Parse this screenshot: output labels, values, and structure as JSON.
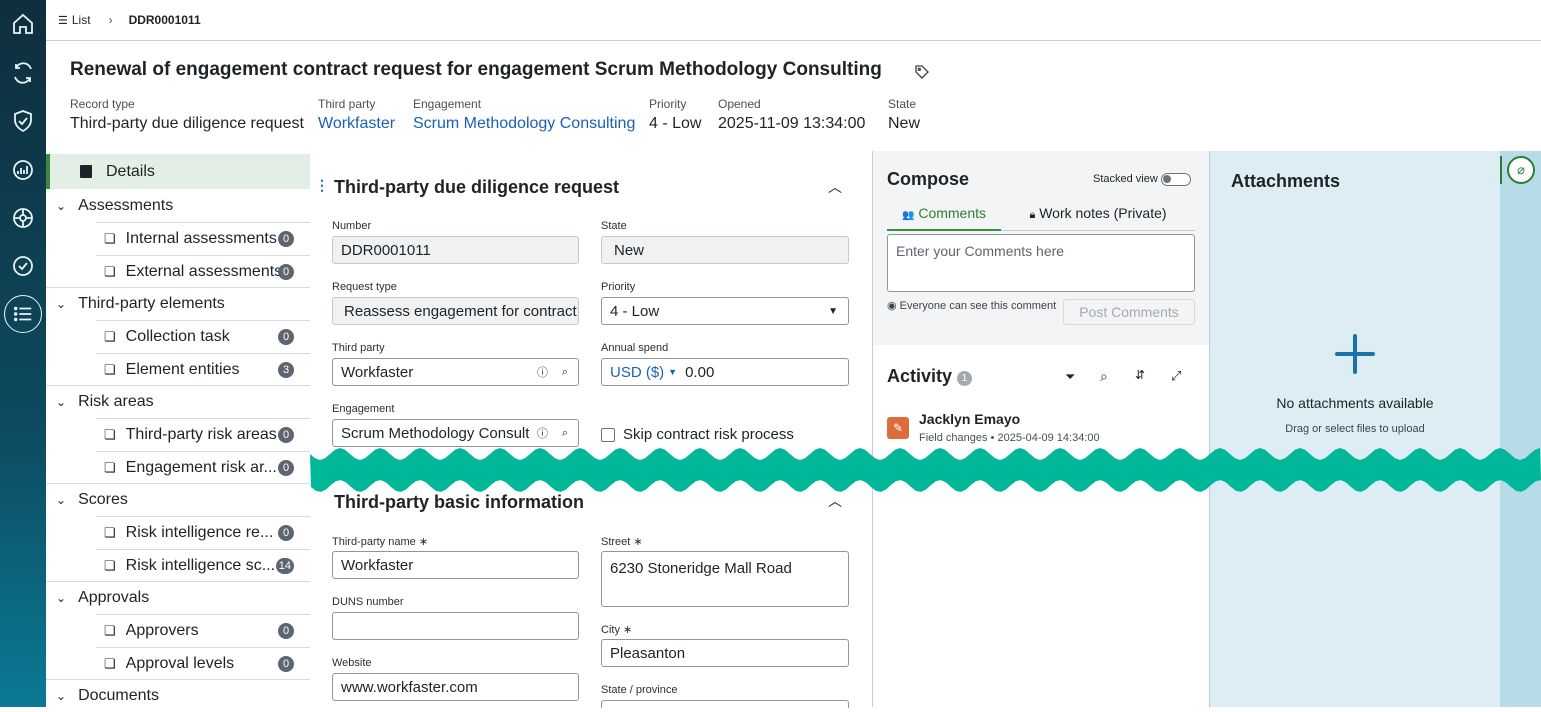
{
  "rail": {
    "icons": [
      "home-icon",
      "refresh-icon",
      "shield-check-icon",
      "analytics-icon",
      "palette-icon",
      "check-circle-icon",
      "list-icon"
    ]
  },
  "breadcrumb": {
    "list_label": "List",
    "record": "DDR0001011"
  },
  "header": {
    "title": "Renewal of engagement contract request for engagement Scrum Methodology Consulting",
    "fields": [
      {
        "label": "Record type",
        "value": "Third-party due diligence request"
      },
      {
        "label": "Third party",
        "value": "Workfaster"
      },
      {
        "label": "Engagement",
        "value": "Scrum Methodology Consulting"
      },
      {
        "label": "Priority",
        "value": "4 - Low"
      },
      {
        "label": "Opened",
        "value": "2025-11-09 13:34:00"
      },
      {
        "label": "State",
        "value": "New"
      }
    ]
  },
  "nav": {
    "details": "Details",
    "groups": [
      {
        "label": "Assessments",
        "items": [
          {
            "label": "Internal assessments",
            "count": "0"
          },
          {
            "label": "External assessments",
            "count": "0"
          }
        ]
      },
      {
        "label": "Third-party elements",
        "items": [
          {
            "label": "Collection task",
            "count": "0"
          },
          {
            "label": "Element entities",
            "count": "3"
          }
        ]
      },
      {
        "label": "Risk areas",
        "items": [
          {
            "label": "Third-party risk areas",
            "count": "0"
          },
          {
            "label": "Engagement risk ar...",
            "count": "0"
          }
        ]
      },
      {
        "label": "Scores",
        "items": [
          {
            "label": "Risk intelligence re...",
            "count": "0"
          },
          {
            "label": "Risk intelligence sc...",
            "count": "14"
          }
        ]
      },
      {
        "label": "Approvals",
        "items": [
          {
            "label": "Approvers",
            "count": "0"
          },
          {
            "label": "Approval levels",
            "count": "0"
          }
        ]
      },
      {
        "label": "Documents",
        "items": []
      }
    ]
  },
  "form": {
    "section1": "Third-party due diligence request",
    "number_label": "Number",
    "number": "DDR0001011",
    "state_label": "State",
    "state": "New",
    "request_type_label": "Request type",
    "request_type": "Reassess engagement for contract r",
    "priority_label": "Priority",
    "priority": "4 - Low",
    "third_party_label": "Third party",
    "third_party": "Workfaster",
    "annual_spend_label": "Annual spend",
    "currency": "USD ($)",
    "annual_spend": "0.00",
    "engagement_label": "Engagement",
    "engagement": "Scrum Methodology Consultir",
    "skip_label": "Skip contract risk process",
    "section2": "Third-party basic information",
    "tp_name_label": "Third-party name",
    "tp_name": "Workfaster",
    "street_label": "Street",
    "street": "6230 Stoneridge Mall Road",
    "duns_label": "DUNS number",
    "duns": "",
    "city_label": "City",
    "city": "Pleasanton",
    "website_label": "Website",
    "website": "www.workfaster.com",
    "state_province_label": "State / province"
  },
  "compose": {
    "title": "Compose",
    "stacked": "Stacked view",
    "tab_comments": "Comments",
    "tab_work_notes": "Work notes (Private)",
    "placeholder": "Enter your Comments here",
    "visibility": "Everyone can see this comment",
    "post": "Post Comments"
  },
  "activity": {
    "title": "Activity",
    "count": "1",
    "entry": {
      "author": "Jacklyn Emayo",
      "type": "Field changes",
      "time": "2025-04-09 14:34:00"
    }
  },
  "attachments": {
    "title": "Attachments",
    "empty": "No attachments available",
    "hint": "Drag or select files to upload"
  },
  "colors": {
    "accent": "#3b8a3f",
    "link": "#1a60b5",
    "wave": "#00b79a"
  }
}
